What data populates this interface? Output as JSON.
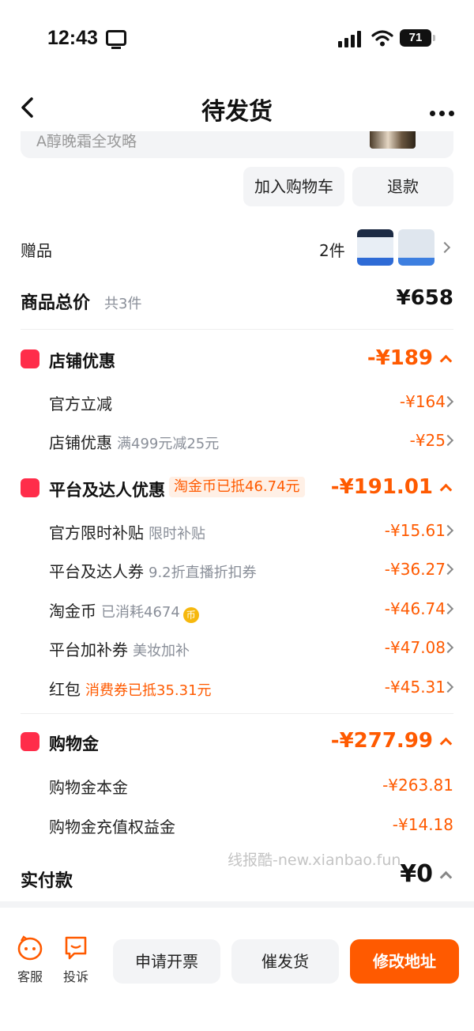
{
  "status": {
    "time": "12:43",
    "battery": "71"
  },
  "nav": {
    "title": "待发货"
  },
  "product": {
    "name": "A醇晚霜全攻略"
  },
  "actions": {
    "add_cart": "加入购物车",
    "refund": "退款"
  },
  "gift": {
    "label": "赠品",
    "count": "2件"
  },
  "total": {
    "label": "商品总价",
    "count": "共3件",
    "value": "¥658"
  },
  "store_discount": {
    "title": "店铺优惠",
    "value": "-¥189",
    "items": [
      {
        "label": "官方立减",
        "note": "",
        "value": "-¥164"
      },
      {
        "label": "店铺优惠",
        "note": "满499元减25元",
        "value": "-¥25"
      }
    ]
  },
  "platform_discount": {
    "title": "平台及达人优惠",
    "badge": "淘金币已抵46.74元",
    "value": "-¥191.01",
    "items": [
      {
        "label": "官方限时补贴",
        "note": "限时补贴",
        "value": "-¥15.61"
      },
      {
        "label": "平台及达人券",
        "note": "9.2折直播折扣券",
        "value": "-¥36.27"
      },
      {
        "label": "淘金币",
        "note": "已消耗4674",
        "value": "-¥46.74"
      },
      {
        "label": "平台加补券",
        "note": "美妆加补",
        "value": "-¥47.08"
      },
      {
        "label": "红包",
        "note": "消费券已抵35.31元",
        "value": "-¥45.31"
      }
    ]
  },
  "shopping_gold": {
    "title": "购物金",
    "value": "-¥277.99",
    "items": [
      {
        "label": "购物金本金",
        "value": "-¥263.81"
      },
      {
        "label": "购物金充值权益金",
        "value": "-¥14.18"
      }
    ]
  },
  "paid": {
    "label": "实付款",
    "value": "¥0"
  },
  "watermark": "线报酷-new.xianbao.fun",
  "bottom": {
    "service": "客服",
    "complaint": "投诉",
    "invoice": "申请开票",
    "urge": "催发货",
    "modify": "修改地址"
  },
  "colors": {
    "accent": "#ff5a00",
    "red": "#ff2d4a"
  }
}
